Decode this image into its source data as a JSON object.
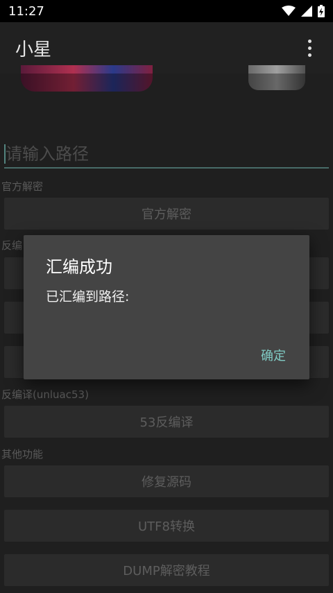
{
  "status_bar": {
    "time": "11:27"
  },
  "app_bar": {
    "title": "小星"
  },
  "path_input": {
    "placeholder": "请输入路径"
  },
  "sections": {
    "official": {
      "label": "官方解密",
      "button": "官方解密"
    },
    "decompile": {
      "label": "反编"
    },
    "decompile53": {
      "label": "反编译(unluac53)",
      "button": "53反编译"
    },
    "other": {
      "label": "其他功能",
      "buttons": [
        "修复源码",
        "UTF8转换",
        "DUMP解密教程"
      ]
    }
  },
  "dialog": {
    "title": "汇编成功",
    "message": "已汇编到路径:",
    "confirm": "确定"
  },
  "colors": {
    "accent": "#80cbc4",
    "background": "#303030",
    "app_bar": "#212121"
  }
}
